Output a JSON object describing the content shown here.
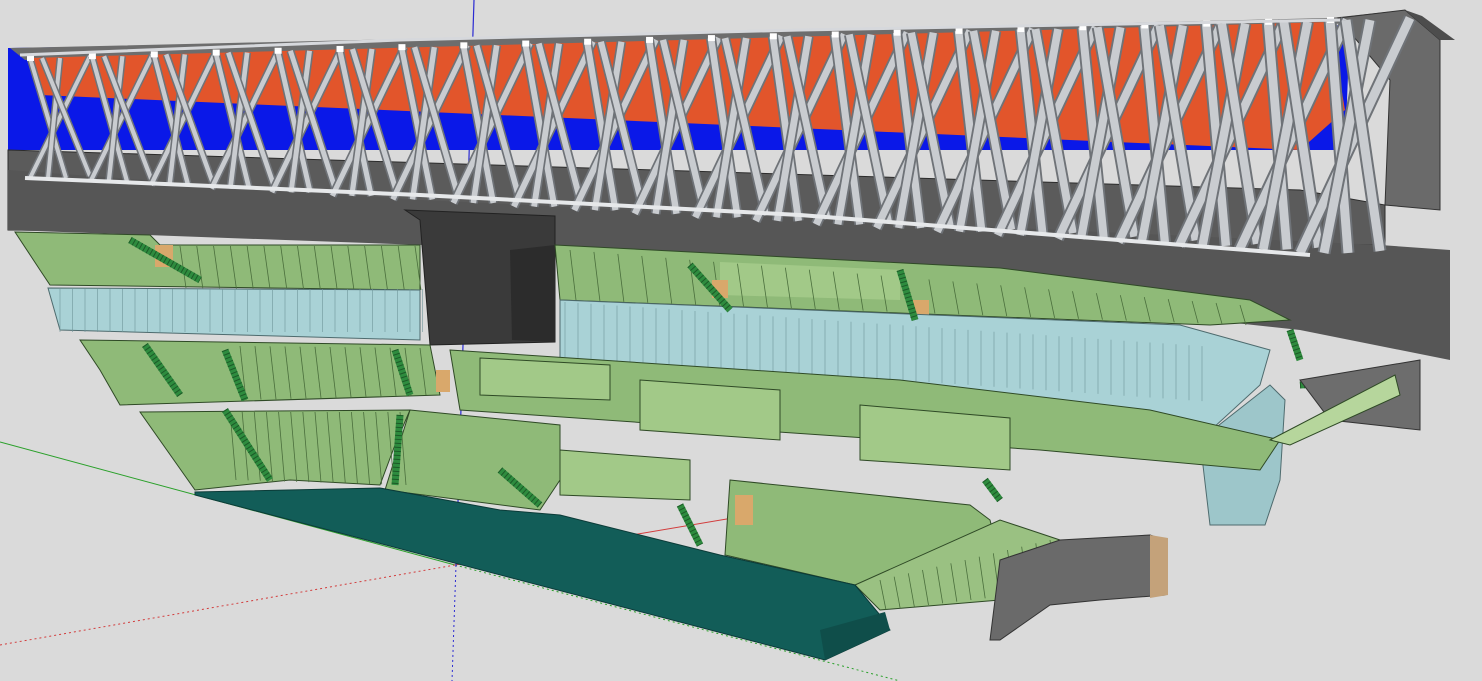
{
  "app": {
    "kind": "3d-modeling-viewport",
    "model": "stadium-section-cutaway"
  },
  "colors": {
    "background": "#dadada",
    "roof_tiles": "#e2552b",
    "roof_band": "#0a18e8",
    "truss": "#c9ccd0",
    "truss_edge": "#6f7378",
    "concrete": "#5a5a5a",
    "concrete_light": "#7a7a7a",
    "seating": "#8fba78",
    "seating_dark": "#5f8a4e",
    "seating_light": "#b6d69c",
    "stairs": "#2e8b3e",
    "glass": "#a9d2d6",
    "pitch": "#125d58",
    "door": "#d9a86b",
    "axis_red": "#d23c3c",
    "axis_green": "#2aa02a",
    "axis_blue": "#2a2ad2"
  },
  "axes": [
    {
      "name": "red-axis",
      "icon": "axis-red-line"
    },
    {
      "name": "green-axis",
      "icon": "axis-green-line"
    },
    {
      "name": "blue-axis",
      "icon": "axis-blue-line"
    }
  ]
}
